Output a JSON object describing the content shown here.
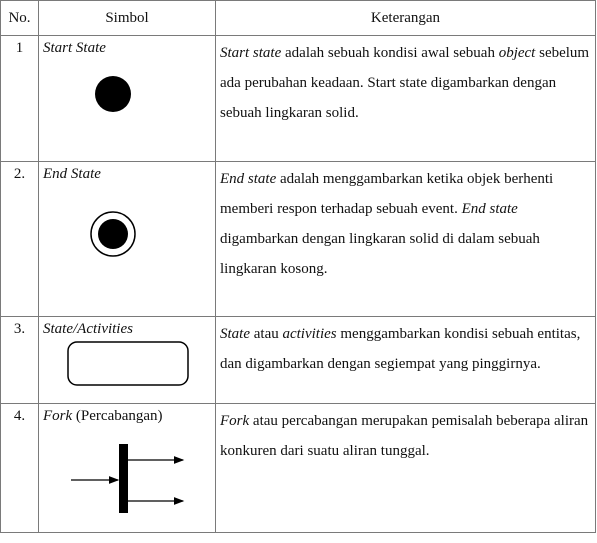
{
  "headers": {
    "no": "No.",
    "symbol": "Simbol",
    "description": "Keterangan"
  },
  "rows": [
    {
      "no": "1",
      "symbol": {
        "italic": "Start State",
        "plain": ""
      },
      "icon": "filled-circle-icon",
      "desc": [
        {
          "t": "Start state",
          "i": true
        },
        {
          "t": " adalah sebuah kondisi awal sebuah ",
          "i": false
        },
        {
          "t": "object",
          "i": true
        },
        {
          "t": " sebelum ada perubahan keadaan. Start state digambarkan dengan sebuah lingkaran solid.",
          "i": false
        }
      ]
    },
    {
      "no": "2.",
      "symbol": {
        "italic": "End State",
        "plain": ""
      },
      "icon": "bullseye-circle-icon",
      "desc": [
        {
          "t": "End state",
          "i": true
        },
        {
          "t": " adalah menggambarkan ketika objek berhenti memberi respon terhadap sebuah event. ",
          "i": false
        },
        {
          "t": "End state",
          "i": true
        },
        {
          "t": " digambarkan dengan lingkaran solid di dalam sebuah lingkaran kosong.",
          "i": false
        }
      ]
    },
    {
      "no": "3.",
      "symbol": {
        "italic": "State/Activities",
        "plain": ""
      },
      "icon": "rounded-rectangle-icon",
      "desc": [
        {
          "t": "State",
          "i": true
        },
        {
          "t": " atau ",
          "i": false
        },
        {
          "t": "activities",
          "i": true
        },
        {
          "t": " menggambarkan kondisi sebuah entitas, dan digambarkan dengan segiempat yang pinggirnya.",
          "i": false
        }
      ]
    },
    {
      "no": "4.",
      "symbol": {
        "italic": "Fork",
        "plain": " (Percabangan)"
      },
      "icon": "fork-bar-icon",
      "desc": [
        {
          "t": "Fork",
          "i": true
        },
        {
          "t": " atau percabangan merupakan pemisalah beberapa aliran konkuren dari suatu aliran tunggal.",
          "i": false
        }
      ]
    }
  ]
}
